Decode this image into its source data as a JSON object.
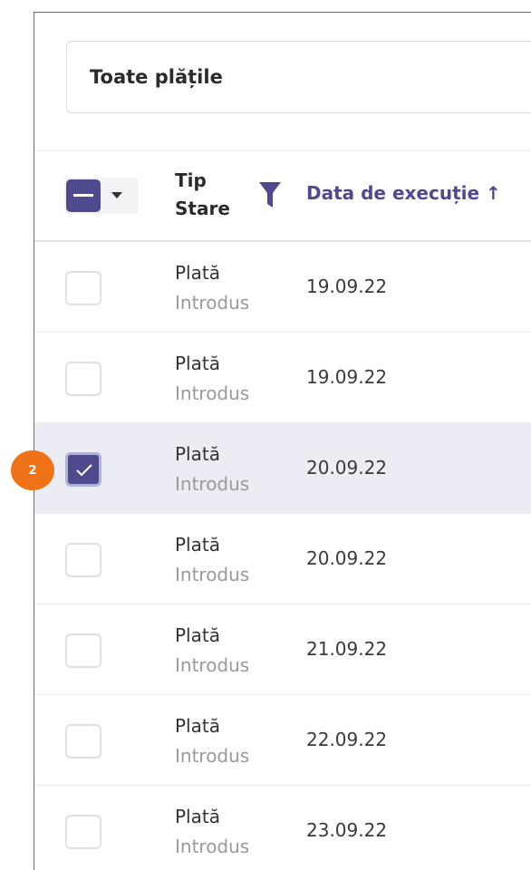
{
  "filter": {
    "label": "Toate plățile"
  },
  "header": {
    "type_label": "Tip",
    "status_label": "Stare",
    "date_label": "Data de execuție ↑"
  },
  "rows": [
    {
      "type": "Plată",
      "status": "Introdus",
      "date": "19.09.22",
      "selected": false
    },
    {
      "type": "Plată",
      "status": "Introdus",
      "date": "19.09.22",
      "selected": false
    },
    {
      "type": "Plată",
      "status": "Introdus",
      "date": "20.09.22",
      "selected": true
    },
    {
      "type": "Plată",
      "status": "Introdus",
      "date": "20.09.22",
      "selected": false
    },
    {
      "type": "Plată",
      "status": "Introdus",
      "date": "21.09.22",
      "selected": false
    },
    {
      "type": "Plată",
      "status": "Introdus",
      "date": "22.09.22",
      "selected": false
    },
    {
      "type": "Plată",
      "status": "Introdus",
      "date": "23.09.22",
      "selected": false
    }
  ],
  "annotation": {
    "step": "2"
  },
  "colors": {
    "accent": "#4f4a8e",
    "badge": "#f07218",
    "selected_row": "#ececf4"
  },
  "icons": {
    "filter": "funnel-icon",
    "check": "checkmark-icon",
    "dropdown": "chevron-down-icon"
  }
}
